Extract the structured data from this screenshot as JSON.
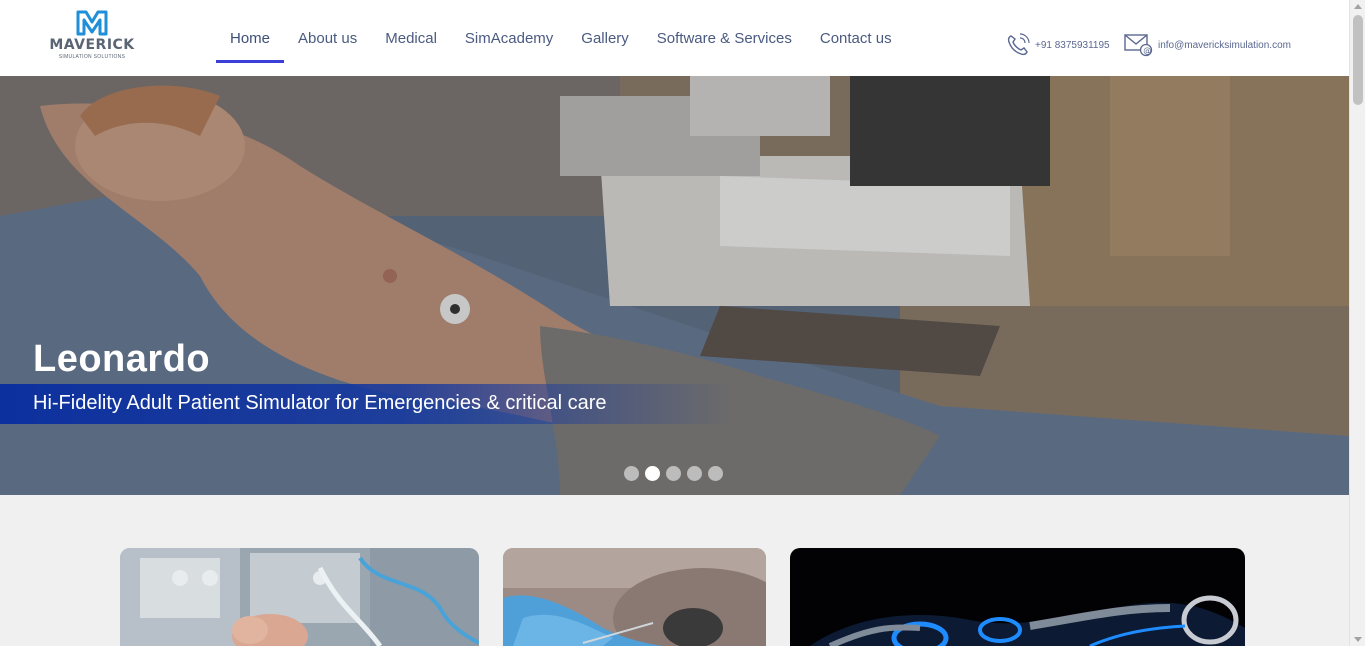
{
  "brand": {
    "name": "MAVERICK",
    "tagline": "SIMULATION SOLUTIONS",
    "logo_color": "#1f8fd8"
  },
  "nav": {
    "items": [
      {
        "label": "Home",
        "active": true
      },
      {
        "label": "About us"
      },
      {
        "label": "Medical"
      },
      {
        "label": "SimAcademy"
      },
      {
        "label": "Gallery"
      },
      {
        "label": "Software & Services"
      },
      {
        "label": "Contact us"
      }
    ],
    "active_color": "#3a3fd8"
  },
  "contact": {
    "phone": "+91 8375931195",
    "phone_icon": "phone-icon",
    "email": "info@mavericksimulation.com",
    "email_icon": "email-icon"
  },
  "hero": {
    "title": "Leonardo",
    "subtitle": "Hi-Fidelity Adult Patient Simulator for Emergencies & critical care",
    "band_color": "#0a2fa0",
    "slides_total": 5,
    "active_slide": 2
  },
  "cards": [
    {
      "name": "neonatal-simulator-card"
    },
    {
      "name": "procedure-trainer-card"
    },
    {
      "name": "robotics-card"
    }
  ]
}
